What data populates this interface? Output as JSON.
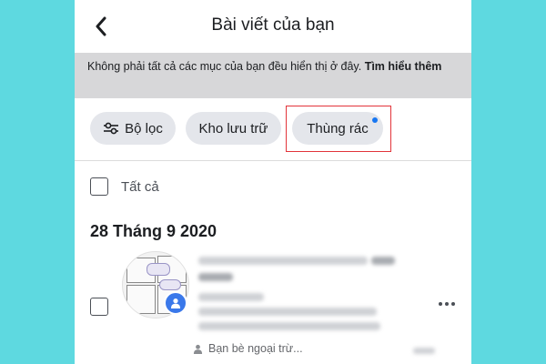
{
  "header": {
    "title": "Bài viết của bạn"
  },
  "notice": {
    "text": "Không phải tất cả các mục của bạn đều hiển thị ở đây. ",
    "link": "Tìm hiểu thêm"
  },
  "filters": {
    "filter_label": "Bộ lọc",
    "archive_label": "Kho lưu trữ",
    "trash_label": "Thùng rác"
  },
  "select_all": {
    "label": "Tất cả"
  },
  "sections": [
    {
      "date": "28 Tháng 9 2020",
      "posts": [
        {
          "audience": "Bạn bè ngoại trừ..."
        }
      ]
    }
  ],
  "colors": {
    "background": "#5ed9e0",
    "notice_bg": "#d7d7d9",
    "chip_bg": "#e4e6eb",
    "highlight_border": "#e2343a",
    "accent_blue": "#1877f2"
  },
  "icons": {
    "back": "chevron-left-icon",
    "filter": "sliders-icon",
    "friends": "person-icon",
    "more": "ellipsis-icon"
  }
}
